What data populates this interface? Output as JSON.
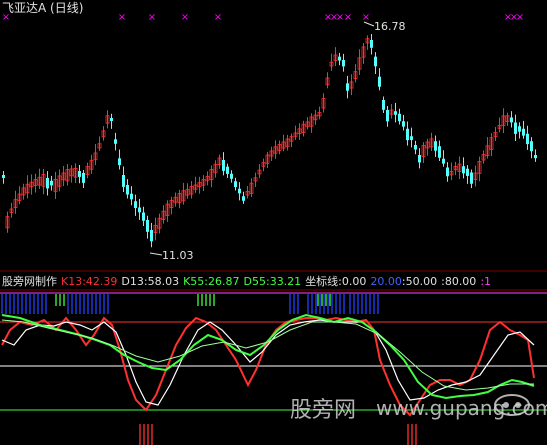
{
  "main_panel": {
    "title": "飞亚达A (日线)",
    "high_label": "16.78",
    "low_label": "11.03",
    "up_color": "#ff3030",
    "down_color": "#54ffff",
    "marker_color": "#ff00ff",
    "marker_glyph": "×"
  },
  "indicator_panel": {
    "name": "股旁网制作",
    "k13": "K13:42.39",
    "d13": "D13:58.03",
    "k55": "K55:26.87",
    "d55": "D55:33.21",
    "coord_label": "坐标线:",
    "coord_0": "0.00",
    "coord_20": "20.00",
    "coord_50": ":50.00",
    "coord_80": ":80.00",
    "coord_1": ":1"
  },
  "watermark": {
    "text": "股旁网",
    "url": "www.gupang.com"
  },
  "chart_data": {
    "type": "candlestick",
    "title": "飞亚达A (日线)",
    "high": 16.78,
    "low": 11.03
  }
}
